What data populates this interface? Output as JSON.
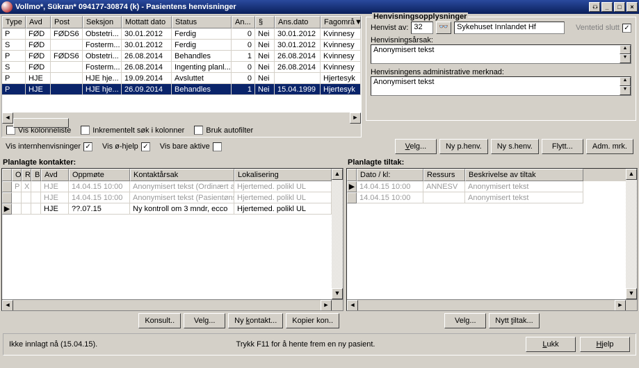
{
  "title": "Vollmo*, Sükran*  094177-30874 (k) - Pasientens henvisninger",
  "grid": {
    "headers": [
      "Type",
      "Avd",
      "Post",
      "Seksjon",
      "Mottatt dato",
      "Status",
      "An...",
      "§",
      "Ans.dato",
      "Fagområ▼"
    ],
    "rows": [
      {
        "c": [
          "P",
          "FØD",
          "FØDS6",
          "Obstetri...",
          "30.01.2012",
          "Ferdig",
          "0",
          "Nei",
          "30.01.2012",
          "Kvinnesy"
        ],
        "sel": false
      },
      {
        "c": [
          "S",
          "FØD",
          "",
          "Fosterm...",
          "30.01.2012",
          "Ferdig",
          "0",
          "Nei",
          "30.01.2012",
          "Kvinnesy"
        ],
        "sel": false
      },
      {
        "c": [
          "P",
          "FØD",
          "FØDS6",
          "Obstetri...",
          "26.08.2014",
          "Behandles",
          "1",
          "Nei",
          "26.08.2014",
          "Kvinnesy"
        ],
        "sel": false
      },
      {
        "c": [
          "S",
          "FØD",
          "",
          "Fosterm...",
          "26.08.2014",
          "Ingenting planl...",
          "0",
          "Nei",
          "26.08.2014",
          "Kvinnesy"
        ],
        "sel": false
      },
      {
        "c": [
          "P",
          "HJE",
          "",
          "HJE hje...",
          "19.09.2014",
          "Avsluttet",
          "0",
          "Nei",
          "",
          "Hjertesyk"
        ],
        "sel": false
      },
      {
        "c": [
          "P",
          "HJE",
          "",
          "HJE hje...",
          "26.09.2014",
          "Behandles",
          "1",
          "Nei",
          "15.04.1999",
          "Hjertesyk"
        ],
        "sel": true
      }
    ]
  },
  "chk_kolonneliste": "Vis kolonneliste",
  "chk_inkrementelt": "Inkrementelt søk i kolonner",
  "chk_autofilter": "Bruk autofilter",
  "chk_intern": "Vis internhenvisninger",
  "chk_ohjelp": "Vis ø-hjelp",
  "chk_aktive": "Vis bare aktive",
  "info": {
    "title": "Henvisningsopplysninger",
    "henvist_av_lbl": "Henvist av:",
    "henvist_av_val": "32",
    "org": "Sykehuset Innlandet Hf",
    "ventetid": "Ventetid slutt",
    "aarsak_lbl": "Henvisningsårsak:",
    "aarsak_val": "Anonymisert tekst",
    "adm_lbl": "Henvisningens administrative merknad:",
    "adm_val": "Anonymisert tekst"
  },
  "btns": {
    "velg": "Velg...",
    "nyphenv": "Ny p.henv.",
    "nyshenv": "Ny s.henv.",
    "flytt": "Flytt...",
    "admmrk": "Adm. mrk.",
    "konsult": "Konsult..",
    "velg2": "Velg...",
    "nykontakt": "Ny kontakt...",
    "kopier": "Kopier kon..",
    "velg3": "Velg...",
    "nytttiltak": "Nytt tiltak...",
    "lukk": "Lukk",
    "hjelp": "Hjelp"
  },
  "planlagte_kontakter": {
    "title": "Planlagte kontakter:",
    "headers": [
      "O",
      "R",
      "B",
      "Avd",
      "Oppmøte",
      "Kontaktårsak",
      "Lokalisering"
    ],
    "rows": [
      {
        "m": "",
        "c": [
          "P",
          "X",
          "",
          "HJE",
          "14.04.15 10:00",
          "Anonymisert tekst (Ordinært av",
          "Hjertemed. polikl UL"
        ],
        "dis": true
      },
      {
        "m": "",
        "c": [
          "",
          "",
          "",
          "HJE",
          "14.04.15 10:00",
          "Anonymisert tekst (Pasientønsk",
          "Hjertemed. polikl UL"
        ],
        "dis": true
      },
      {
        "m": "▶",
        "c": [
          "",
          "",
          "",
          "HJE",
          "??.07.15",
          "Ny kontroll om 3 mndr, ecco",
          "Hjertemed. polikl UL"
        ],
        "dis": false
      }
    ]
  },
  "planlagte_tiltak": {
    "title": "Planlagte tiltak:",
    "headers": [
      "Dato / kl:",
      "Ressurs",
      "Beskrivelse av tiltak"
    ],
    "rows": [
      {
        "m": "▶",
        "c": [
          "14.04.15 10:00",
          "ANNESV",
          "Anonymisert tekst"
        ],
        "dis": true
      },
      {
        "m": "",
        "c": [
          "14.04.15 10:00",
          "",
          "Anonymisert tekst"
        ],
        "dis": true
      }
    ]
  },
  "status_left": "Ikke innlagt nå (15.04.15).",
  "status_center": "Trykk F11 for å hente frem en ny pasient."
}
